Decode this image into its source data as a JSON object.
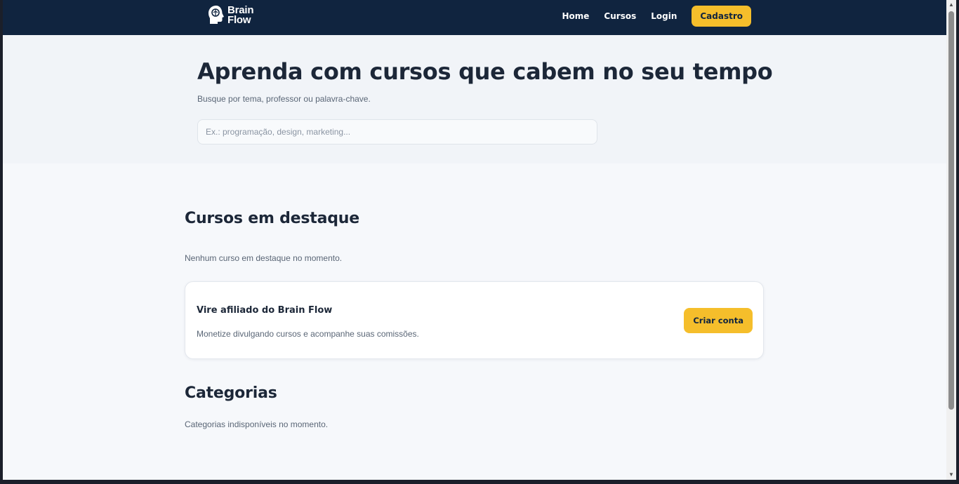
{
  "header": {
    "logo_line1": "Brain",
    "logo_line2": "Flow",
    "nav": [
      {
        "label": "Home"
      },
      {
        "label": "Cursos"
      },
      {
        "label": "Login"
      }
    ],
    "signup_label": "Cadastro"
  },
  "hero": {
    "title": "Aprenda com cursos que cabem no seu tempo",
    "subtitle": "Busque por tema, professor ou palavra-chave.",
    "search_placeholder": "Ex.: programação, design, marketing..."
  },
  "featured": {
    "title": "Cursos em destaque",
    "empty_text": "Nenhum curso em destaque no momento."
  },
  "affiliate": {
    "title": "Vire afiliado do Brain Flow",
    "description": "Monetize divulgando cursos e acompanhe suas comissões.",
    "button_label": "Criar conta"
  },
  "categories": {
    "title": "Categorias",
    "empty_text": "Categorias indisponíveis no momento."
  },
  "colors": {
    "header_bg": "#10243f",
    "accent": "#f5be2b",
    "text_dark": "#1c2738",
    "text_muted": "#5a6676"
  },
  "icons": {
    "logo": "brain-head-icon"
  }
}
